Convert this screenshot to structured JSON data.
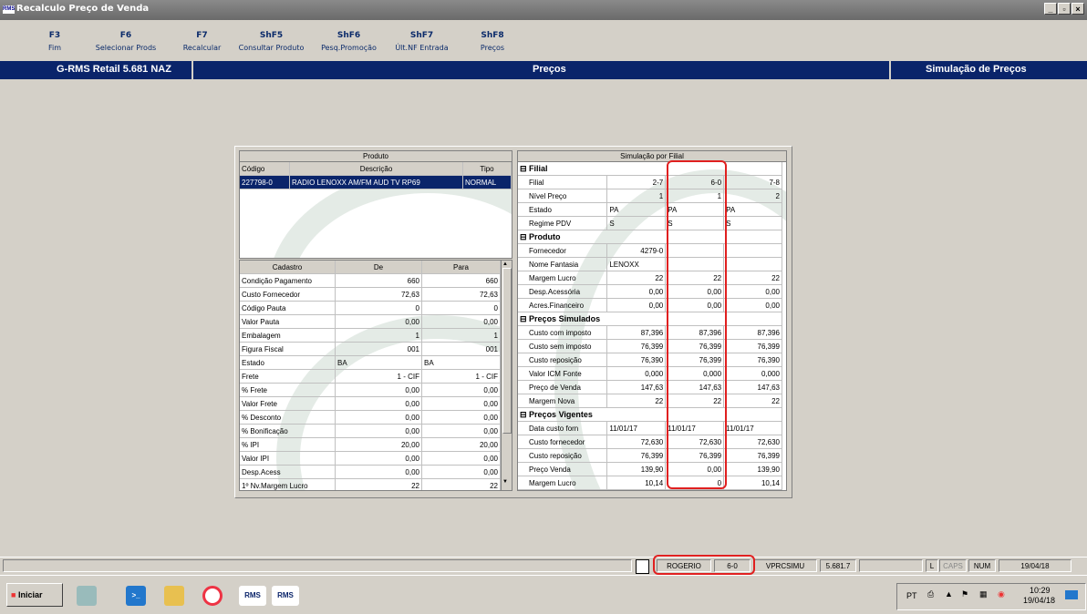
{
  "window": {
    "title": "Recalculo Preço de Venda",
    "app_icon": "RMS",
    "btn_min": "_",
    "btn_max": "▫",
    "btn_close": "×"
  },
  "toolbar": [
    {
      "key": "F3",
      "label": "Fim"
    },
    {
      "key": "F6",
      "label": "Selecionar Prods"
    },
    {
      "key": "F7",
      "label": "Recalcular"
    },
    {
      "key": "ShF5",
      "label": "Consultar Produto"
    },
    {
      "key": "ShF6",
      "label": "Pesq.Promoção"
    },
    {
      "key": "ShF7",
      "label": "Últ.NF Entrada"
    },
    {
      "key": "ShF8",
      "label": "Preços"
    }
  ],
  "bluebar": {
    "version": "G-RMS Retail 5.681 NAZ",
    "center": "Preços",
    "right": "Simulação de Preços"
  },
  "produto": {
    "header": "Produto",
    "cols": [
      "Código",
      "Descrição",
      "Tipo"
    ],
    "row": {
      "codigo": "227798-0",
      "descricao": "RADIO LENOXX AM/FM AUD TV RP69",
      "tipo": "NORMAL"
    }
  },
  "cadastro": {
    "cols": [
      "Cadastro",
      "De",
      "Para"
    ],
    "rows": [
      [
        "Condição Pagamento",
        "660",
        "660"
      ],
      [
        "Custo Fornecedor",
        "72,63",
        "72,63"
      ],
      [
        "Código Pauta",
        "0",
        "0"
      ],
      [
        "Valor Pauta",
        "0,00",
        "0,00"
      ],
      [
        "Embalagem",
        "1",
        "1"
      ],
      [
        "Figura Fiscal",
        "001",
        "001"
      ],
      [
        "Estado",
        "BA",
        "BA"
      ],
      [
        "Frete",
        "1 - CIF",
        "1 - CIF"
      ],
      [
        "% Frete",
        "0,00",
        "0,00"
      ],
      [
        "Valor Frete",
        "0,00",
        "0,00"
      ],
      [
        "% Desconto",
        "0,00",
        "0,00"
      ],
      [
        "% Bonificação",
        "0,00",
        "0,00"
      ],
      [
        "% IPI",
        "20,00",
        "20,00"
      ],
      [
        "Valor IPI",
        "0,00",
        "0,00"
      ],
      [
        "Desp.Acess",
        "0,00",
        "0,00"
      ],
      [
        "1º Nv.Margem Lucro",
        "22",
        "22"
      ]
    ]
  },
  "simulacao": {
    "header": "Simulação por Filial",
    "sections": [
      {
        "title": "Filial",
        "rows": [
          [
            "Filial",
            "2-7",
            "6-0",
            "7-8"
          ],
          [
            "Nível Preço",
            "1",
            "1",
            "2"
          ],
          [
            "Estado",
            "PA",
            "PA",
            "PA"
          ],
          [
            "Regime PDV",
            "S",
            "S",
            "S"
          ]
        ]
      },
      {
        "title": "Produto",
        "rows": [
          [
            "Fornecedor",
            "4279-0",
            "",
            ""
          ],
          [
            "Nome Fantasia",
            "LENOXX",
            "",
            ""
          ],
          [
            "Margem Lucro",
            "22",
            "22",
            "22"
          ],
          [
            "Desp.Acessória",
            "0,00",
            "0,00",
            "0,00"
          ],
          [
            "Acres.Financeiro",
            "0,00",
            "0,00",
            "0,00"
          ]
        ]
      },
      {
        "title": "Preços Simulados",
        "rows": [
          [
            "Custo com imposto",
            "87,396",
            "87,396",
            "87,396"
          ],
          [
            "Custo sem imposto",
            "76,399",
            "76,399",
            "76,399"
          ],
          [
            "Custo reposição",
            "76,390",
            "76,399",
            "76,390"
          ],
          [
            "Valor ICM Fonte",
            "0,000",
            "0,000",
            "0,000"
          ],
          [
            "Preço de Venda",
            "147,63",
            "147,63",
            "147,63"
          ],
          [
            "Margem Nova",
            "22",
            "22",
            "22"
          ]
        ]
      },
      {
        "title": "Preços Vigentes",
        "rows": [
          [
            "Data custo forn",
            "11/01/17",
            "11/01/17",
            "11/01/17"
          ],
          [
            "Custo fornecedor",
            "72,630",
            "72,630",
            "72,630"
          ],
          [
            "Custo reposição",
            "76,399",
            "76,399",
            "76,399"
          ],
          [
            "Preço Venda",
            "139,90",
            "0,00",
            "139,90"
          ],
          [
            "Margem Lucro",
            "10,14",
            "0",
            "10,14"
          ]
        ]
      }
    ]
  },
  "status": {
    "user": "ROGERIO",
    "filial": "6-0",
    "program": "VPRCSIMU",
    "version": "5.681.7",
    "l": "L",
    "caps": "CAPS",
    "num": "NUM",
    "date": "19/04/18"
  },
  "taskbar": {
    "start": "Iniciar",
    "lang": "PT",
    "time": "10:29",
    "date": "19/04/18",
    "rms1": "RMS",
    "rms2": "RMS"
  }
}
